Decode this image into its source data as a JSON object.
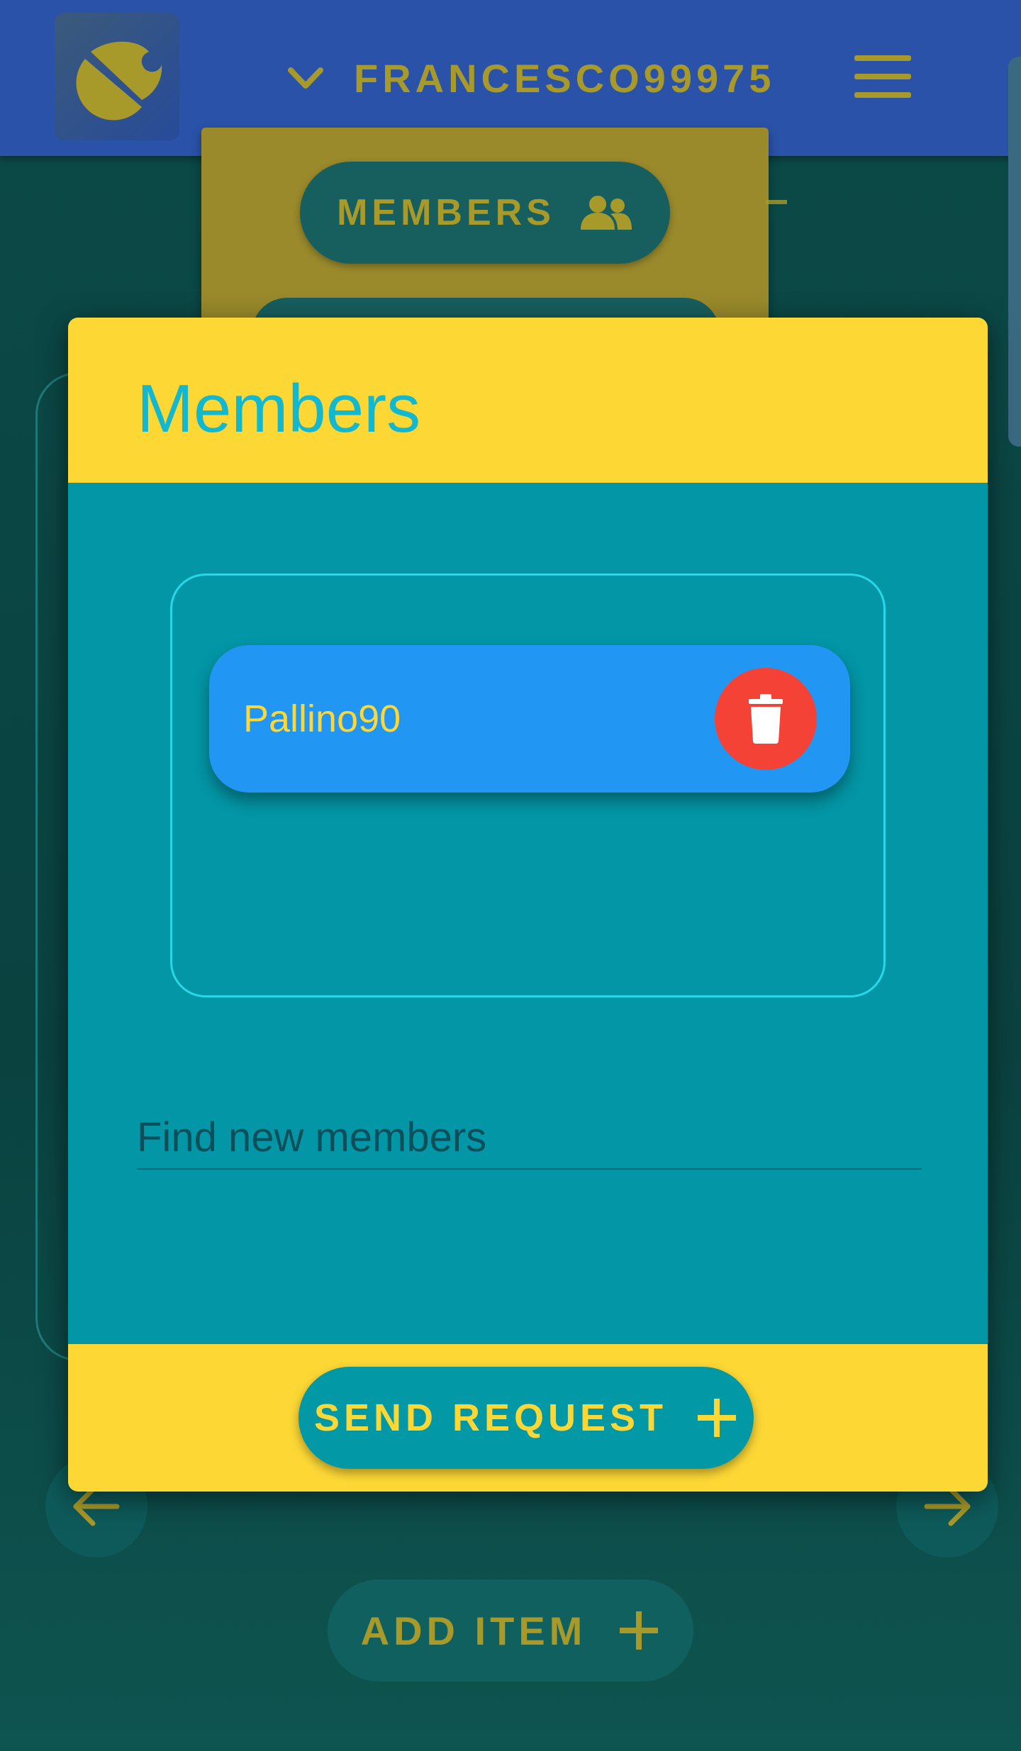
{
  "header": {
    "username": "FRANCESCO99975"
  },
  "background": {
    "members_button_label": "MEMBERS",
    "add_item_label": "ADD ITEM"
  },
  "dialog": {
    "title": "Members",
    "members": [
      {
        "name": "Pallino90"
      }
    ],
    "search": {
      "placeholder": "Find new members",
      "value": ""
    },
    "send_request_label": "SEND REQUEST"
  },
  "icons": {
    "logo": "app-logo-icon",
    "user_toggle": "chevron-down-icon",
    "menu": "hamburger-menu-icon",
    "members": "group-icon",
    "delete": "trash-icon",
    "send": "plus-icon",
    "prev": "arrow-left-icon",
    "next": "arrow-right-icon",
    "add": "plus-icon"
  },
  "colors": {
    "app_bar": "#2a52a8",
    "dialog_accent": "#fdd835",
    "dialog_body": "#0396a6",
    "member_chip": "#2196f3",
    "delete_button": "#f44336",
    "title_text": "#12b8d0"
  }
}
